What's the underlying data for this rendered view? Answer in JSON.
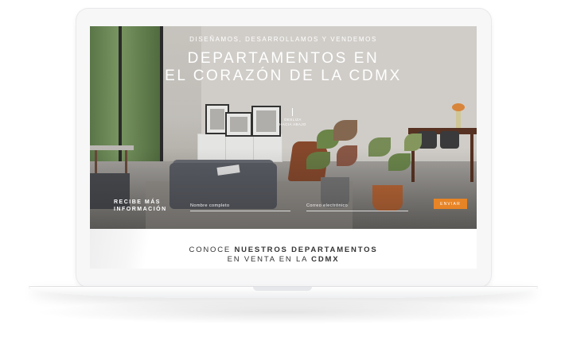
{
  "hero": {
    "eyebrow": "DISEÑAMOS, DESARROLLAMOS Y VENDEMOS",
    "headline_line1": "DEPARTAMENTOS EN",
    "headline_line2": "EL CORAZÓN DE LA CDMX",
    "scroll_hint_line1": "DESLIZA",
    "scroll_hint_line2": "HACIA ABAJO"
  },
  "form": {
    "label_line1": "RECIBE MÁS",
    "label_line2": "INFORMACIÓN",
    "name_placeholder": "Nombre completo",
    "email_placeholder": "Correo electrónico",
    "submit_label": "ENVIAR"
  },
  "section": {
    "title_prefix": "CONOCE ",
    "title_bold_1": "NUESTROS DEPARTAMENTOS",
    "title_line2_prefix": "EN VENTA EN LA ",
    "title_bold_2": "CDMX"
  },
  "colors": {
    "accent": "#e78425",
    "device": "#f7f7f8",
    "text_dark": "#333333"
  }
}
